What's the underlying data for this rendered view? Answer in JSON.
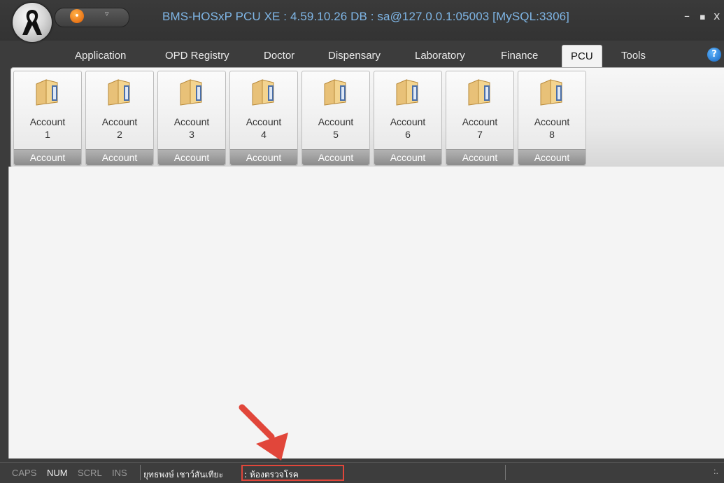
{
  "window": {
    "title": "BMS-HOSxP PCU XE : 4.59.10.26 DB : sa@127.0.0.1:05003 [MySQL:3306]",
    "controls": [
      "–",
      "▪",
      "x"
    ]
  },
  "quick_access": {
    "icon": "lock-icon",
    "dropdown": "▿"
  },
  "tabs": {
    "application": "Application",
    "opd_registry": "OPD Registry",
    "doctor": "Doctor",
    "dispensary": "Dispensary",
    "laboratory": "Laboratory",
    "finance": "Finance",
    "pcu": "PCU",
    "tools": "Tools",
    "active": "PCU"
  },
  "help": "?",
  "ribbon": {
    "groups": [
      {
        "label": "Account",
        "num": "1",
        "caption": "Account"
      },
      {
        "label": "Account",
        "num": "2",
        "caption": "Account"
      },
      {
        "label": "Account",
        "num": "3",
        "caption": "Account"
      },
      {
        "label": "Account",
        "num": "4",
        "caption": "Account"
      },
      {
        "label": "Account",
        "num": "5",
        "caption": "Account"
      },
      {
        "label": "Account",
        "num": "6",
        "caption": "Account"
      },
      {
        "label": "Account",
        "num": "7",
        "caption": "Account"
      },
      {
        "label": "Account",
        "num": "8",
        "caption": "Account"
      }
    ]
  },
  "status": {
    "caps": "CAPS",
    "num": "NUM",
    "scrl": "SCRL",
    "ins": "INS",
    "user": "ยุทธพงษ์ เชาว์สันเทียะ",
    "room": ": ห้องตรวจโรค"
  },
  "colors": {
    "title": "#7fb6e6",
    "highlight": "#e1463a"
  }
}
